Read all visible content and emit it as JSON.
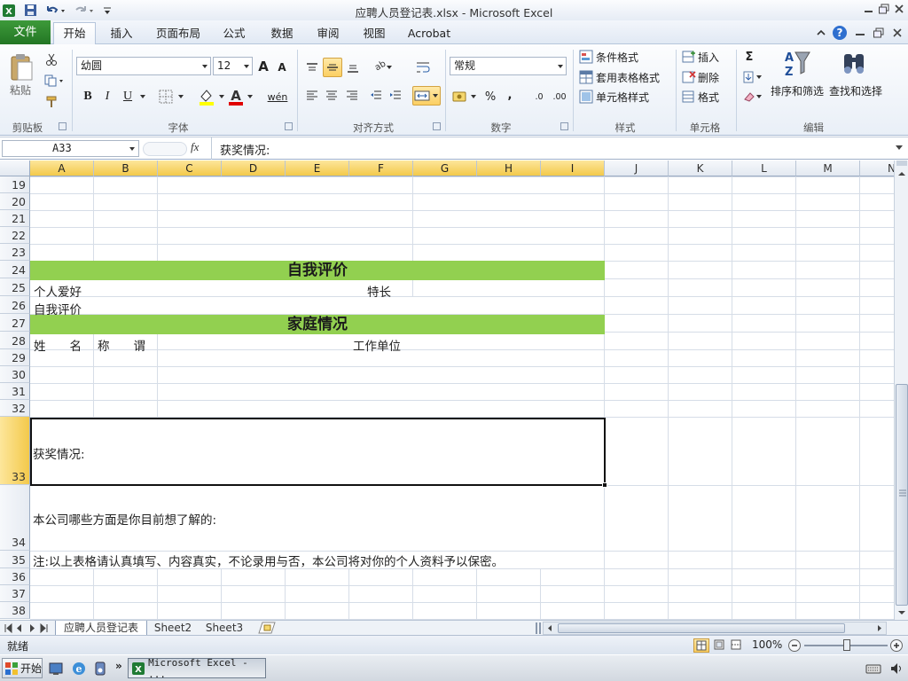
{
  "window": {
    "title": "应聘人员登记表.xlsx  -  Microsoft Excel"
  },
  "tabs": [
    "文件",
    "开始",
    "插入",
    "页面布局",
    "公式",
    "数据",
    "审阅",
    "视图",
    "Acrobat"
  ],
  "ribbon": {
    "clipboard": {
      "paste": "粘贴",
      "group": "剪贴板"
    },
    "font": {
      "name": "幼圆",
      "size": "12",
      "group": "字体",
      "bold": "B",
      "italic": "I",
      "underline": "U",
      "grow": "A",
      "shrink": "A",
      "wen": "wén"
    },
    "align": {
      "group": "对齐方式"
    },
    "number": {
      "format": "常规",
      "group": "数字",
      "percent": "%",
      "comma": ",",
      "inc": ".0",
      "dec": ".00"
    },
    "styles": {
      "conditional": "条件格式",
      "table": "套用表格格式",
      "cell": "单元格样式",
      "group": "样式"
    },
    "cells": {
      "insert": "插入",
      "delete": "删除",
      "format": "格式",
      "group": "单元格"
    },
    "editing": {
      "sort": "排序和筛选",
      "find": "查找和选择",
      "group": "编辑",
      "sigma": "Σ"
    }
  },
  "formula_bar": {
    "name_box": "A33",
    "fx": "fx",
    "content": "获奖情况:"
  },
  "columns": [
    "A",
    "B",
    "C",
    "D",
    "E",
    "F",
    "G",
    "H",
    "I",
    "J",
    "K",
    "L",
    "M",
    "N"
  ],
  "rows": [
    "19",
    "20",
    "21",
    "22",
    "23",
    "24",
    "25",
    "26",
    "27",
    "28",
    "29",
    "30",
    "31",
    "32",
    "33",
    "34",
    "35",
    "36",
    "37",
    "38"
  ],
  "cells": {
    "banner_self": "自我评价",
    "hobby": "个人爱好",
    "specialty": "特长",
    "self_eval": "自我评价",
    "banner_family": "家庭情况",
    "name": "姓　　名",
    "title": "称　　谓",
    "workplace": "工作单位",
    "awards": "获奖情况:",
    "want_know": "本公司哪些方面是你目前想了解的:",
    "note": "注:以上表格请认真填写、内容真实，不论录用与否，本公司将对你的个人资料予以保密。"
  },
  "sheets": [
    "应聘人员登记表",
    "Sheet2",
    "Sheet3"
  ],
  "status": {
    "text": "就绪",
    "zoom": "100%"
  },
  "taskbar": {
    "start": "开始",
    "task": "Microsoft Excel - ..."
  },
  "colors": {
    "accent": "#92d050",
    "file_tab": "#2d8a2d",
    "selected_header": "#f3c94b"
  }
}
